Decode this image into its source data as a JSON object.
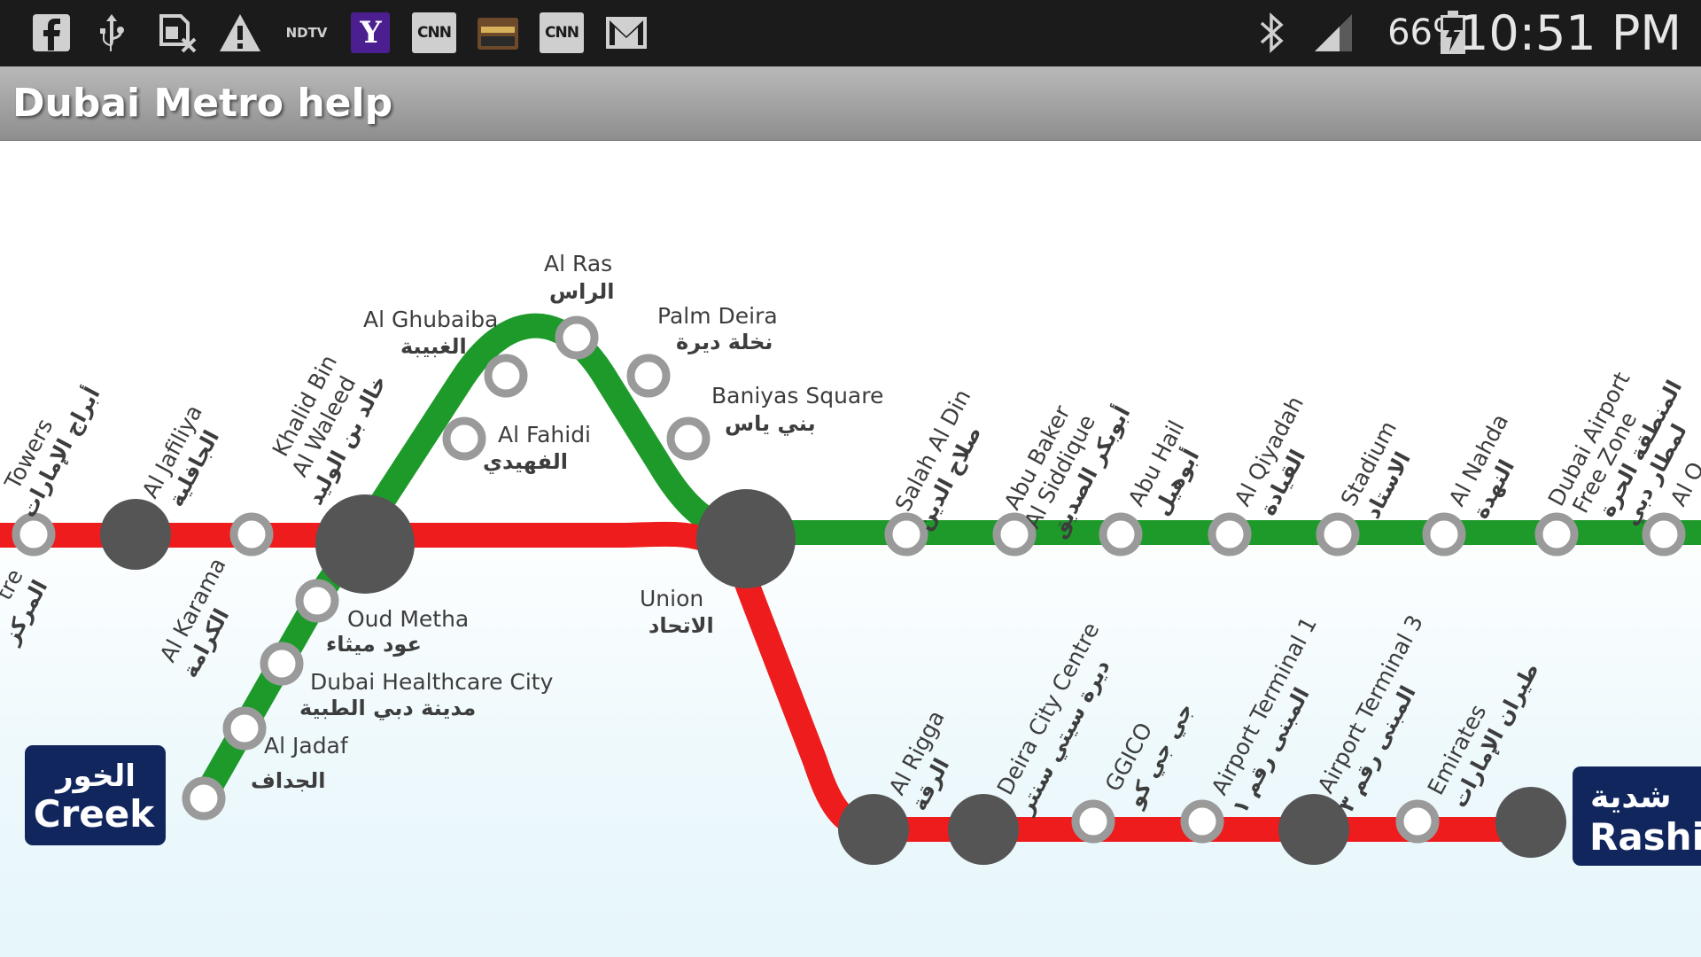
{
  "status_bar": {
    "icons": [
      "facebook-icon",
      "usb-icon",
      "sim-card-icon",
      "warning-icon",
      "ndtv-icon",
      "yahoo-icon",
      "cnn-icon",
      "kaaba-icon",
      "cnn-icon",
      "gmail-icon"
    ],
    "ndtv_label": "NDTV",
    "yahoo_label": "Y",
    "cnn_label": "CNN",
    "cnn2_label": "CNN",
    "battery_percent": "66%",
    "time": "10:51 PM"
  },
  "action_bar": {
    "title": "Dubai Metro help"
  },
  "colors": {
    "red_line": "#ee1c1c",
    "green_line": "#1e9a2b",
    "interchange": "#555555",
    "station_ring": "#9a9a9a",
    "badge": "#12265e"
  },
  "stations": {
    "burjuman_towers_en": "Towers",
    "burjuman_towers_ar": "أبراج الإمارات",
    "left_centre_en": "tre",
    "left_centre_ar": "المركز",
    "al_jafiliya_en": "Al Jafiliya",
    "al_jafiliya_ar": "الجافلية",
    "al_karama_en": "Al Karama",
    "al_karama_ar": "الكرامة",
    "khalid_en_1": "Khalid Bin",
    "khalid_en_2": "Al Waleed",
    "khalid_ar": "خالد بن الوليد",
    "al_ghubaiba_en": "Al Ghubaiba",
    "al_ghubaiba_ar": "الغبيبة",
    "al_ras_en": "Al Ras",
    "al_ras_ar": "الراس",
    "palm_deira_en": "Palm Deira",
    "palm_deira_ar": "نخلة ديرة",
    "al_fahidi_en": "Al Fahidi",
    "al_fahidi_ar": "الفهيدي",
    "baniyas_en": "Baniyas Square",
    "baniyas_ar": "بني ياس",
    "union_en": "Union",
    "union_ar": "الاتحاد",
    "oud_metha_en": "Oud Metha",
    "oud_metha_ar": "عود ميثاء",
    "dhcc_en": "Dubai Healthcare City",
    "dhcc_ar": "مدينة دبي الطبية",
    "al_jadaf_en": "Al Jadaf",
    "al_jadaf_ar": "الجداف",
    "salah_en": "Salah Al Din",
    "salah_ar": "صلاح الدين",
    "abu_baker_en_1": "Abu Baker",
    "abu_baker_en_2": "Al Siddique",
    "abu_baker_ar": "أبوبكر الصديق",
    "abu_hail_en": "Abu Hail",
    "abu_hail_ar": "أبوهيل",
    "al_qiyadah_en": "Al Qiyadah",
    "al_qiyadah_ar": "القيادة",
    "stadium_en": "Stadium",
    "stadium_ar": "الاستاد",
    "al_nahda_en": "Al Nahda",
    "al_nahda_ar": "النهدة",
    "dafz_en_1": "Dubai Airport",
    "dafz_en_2": "Free Zone",
    "dafz_ar_1": "المنطقة الحرة",
    "dafz_ar_2": "لمطار دبي",
    "al_q_partial": "Al Q",
    "al_rigga_en": "Al Rigga",
    "al_rigga_ar": "الرقة",
    "dcc_en": "Deira City Centre",
    "dcc_ar": "ديرة سيتي سنتر",
    "ggico_en": "GGICO",
    "ggico_ar": "جي جي كو",
    "at1_en": "Airport Terminal 1",
    "at1_ar": "المبنى رقم ١",
    "at3_en": "Airport Terminal 3",
    "at3_ar": "المبنى رقم ٣",
    "emirates_en": "Emirates",
    "emirates_ar": "طيران الإمارات"
  },
  "badges": {
    "creek_ar": "الخور",
    "creek_en": "Creek",
    "rashidiya_ar": "شدية",
    "rashidiya_en": "Rashid"
  }
}
